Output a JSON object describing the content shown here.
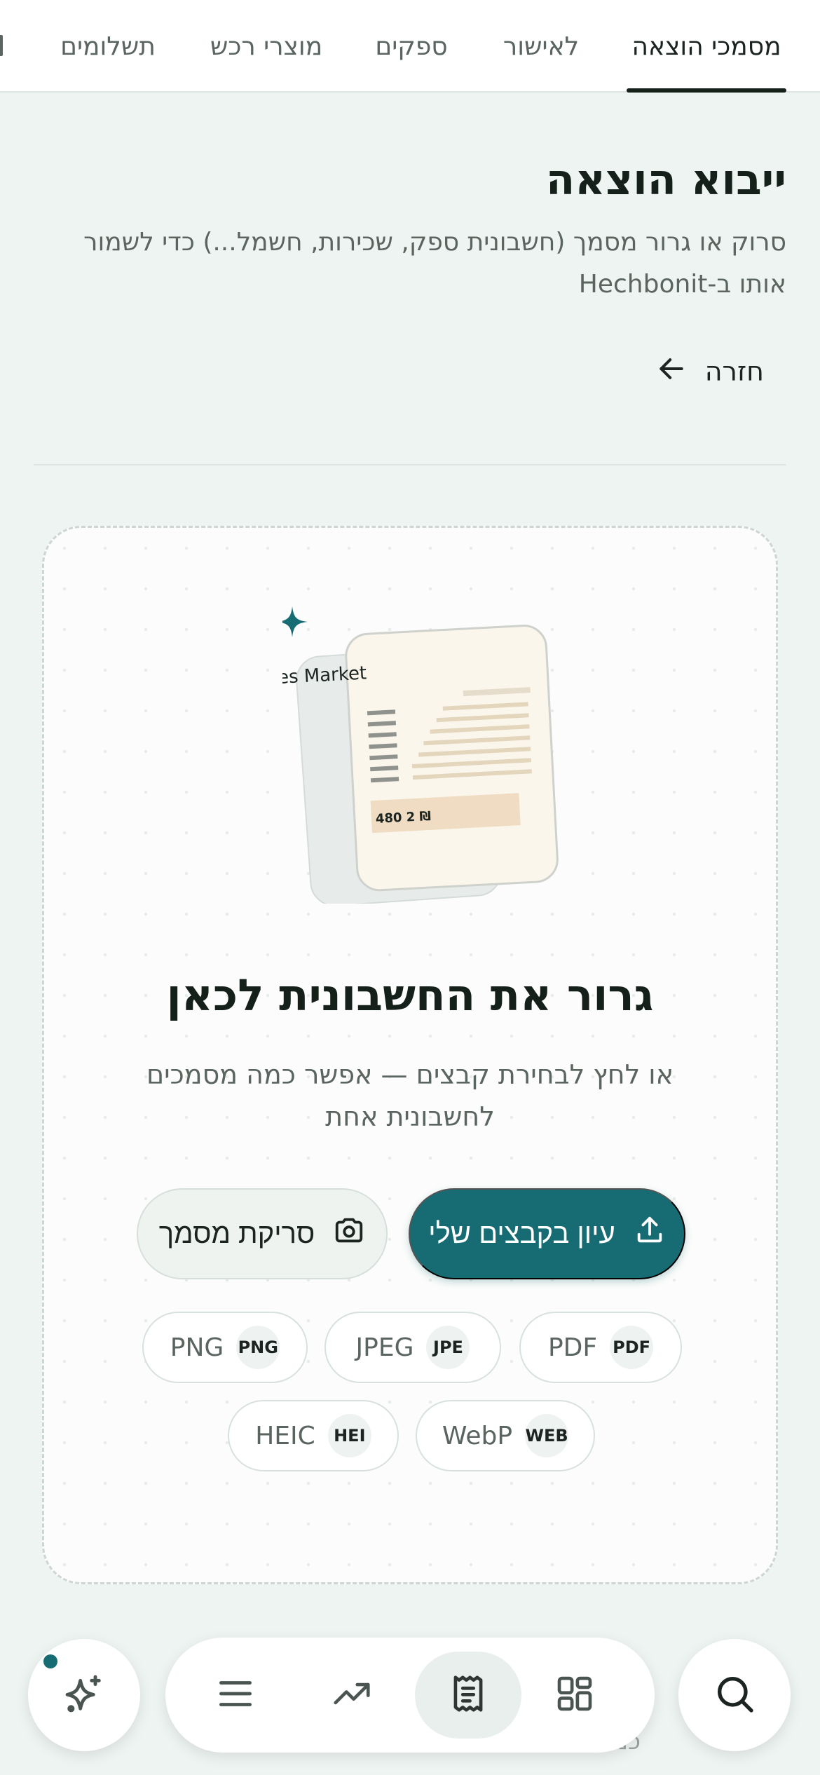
{
  "tabs": [
    {
      "label": "מסמכי הוצאה",
      "active": true
    },
    {
      "label": "לאישור",
      "active": false
    },
    {
      "label": "ספקים",
      "active": false
    },
    {
      "label": "מוצרי רכש",
      "active": false
    },
    {
      "label": "תשלומים",
      "active": false
    }
  ],
  "header": {
    "title": "ייבוא הוצאה",
    "subtitle": "סרוק או גרור מסמך (חשבונית ספק, שכירות, חשמל...) כדי לשמור אותו ב-Hechbonit",
    "back_label": "חזרה"
  },
  "dropzone": {
    "illustration": {
      "merchant": "Délices Market",
      "amount": "480 2 ₪"
    },
    "title": "גרור את החשבונית לכאן",
    "subtitle": "או לחץ לבחירת קבצים — אפשר כמה מסמכים לחשבונית אחת",
    "browse_label": "עיון בקבצים שלי",
    "scan_label": "סריקת מסמך",
    "formats": [
      {
        "label": "PDF",
        "badge": "PDF"
      },
      {
        "label": "JPEG",
        "badge": "JPE"
      },
      {
        "label": "PNG",
        "badge": "PNG"
      },
      {
        "label": "WebP",
        "badge": "WEB"
      },
      {
        "label": "HEIC",
        "badge": "HEI"
      }
    ]
  },
  "peek_text": "כמה",
  "bottom_nav": {
    "items": [
      "grid-icon",
      "receipt-icon",
      "trending-icon",
      "menu-icon"
    ],
    "active": "receipt-icon",
    "fabs": [
      "sparkle-icon",
      "search-icon"
    ]
  },
  "colors": {
    "accent": "#176c74",
    "background": "#eef4f1",
    "text": "#15201b",
    "muted": "#5b6560"
  }
}
